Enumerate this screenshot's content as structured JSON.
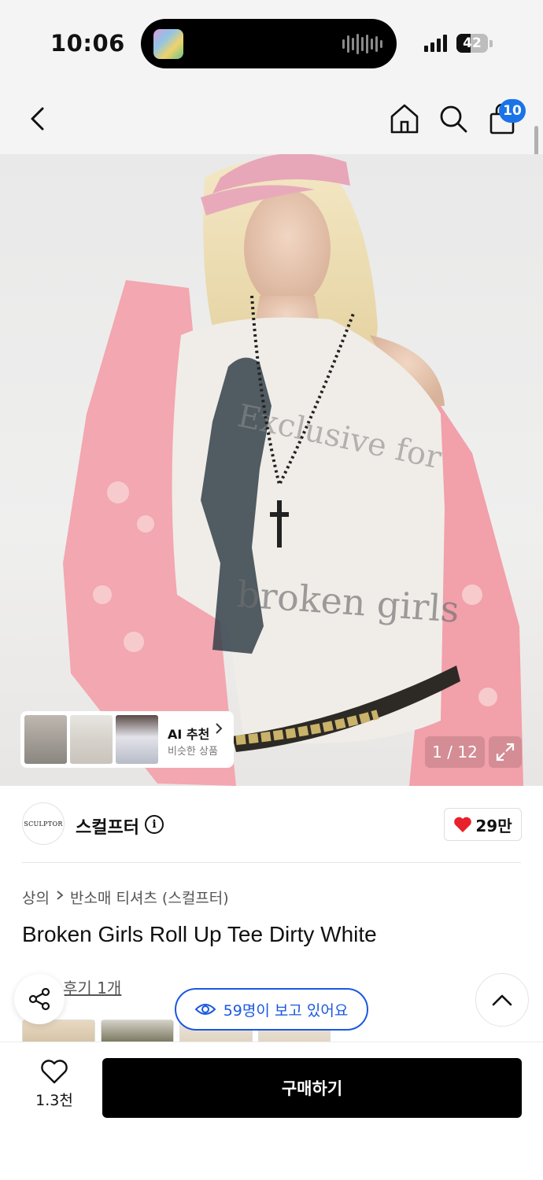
{
  "status_bar": {
    "time": "10:06",
    "battery": "42"
  },
  "nav": {
    "back_icon": "chevron-left-icon",
    "home_icon": "home-icon",
    "search_icon": "search-icon",
    "cart_icon": "shopping-bag-icon",
    "cart_count": "10",
    "badge_color": "#1a73e8"
  },
  "gallery": {
    "counter": "1 / 12",
    "expand_icon": "expand-icon",
    "ai_recommend": {
      "title": "AI 추천",
      "subtitle": "비슷한 상품"
    }
  },
  "brand": {
    "logo_text": "SCULPTOR",
    "name": "스컬프터",
    "like_count": "29만",
    "heart_color": "#e8212b"
  },
  "product": {
    "breadcrumb": [
      "상의",
      "반소매 티셔츠 (스컬프터)"
    ],
    "title": "Broken Girls Roll Up Tee Dirty White",
    "review_link": "후기 1개"
  },
  "floating": {
    "viewers_text": "59명이 보고 있어요",
    "accent_color": "#1a58e0"
  },
  "bottom_bar": {
    "wishlist_count": "1.3천",
    "buy_label": "구매하기"
  }
}
